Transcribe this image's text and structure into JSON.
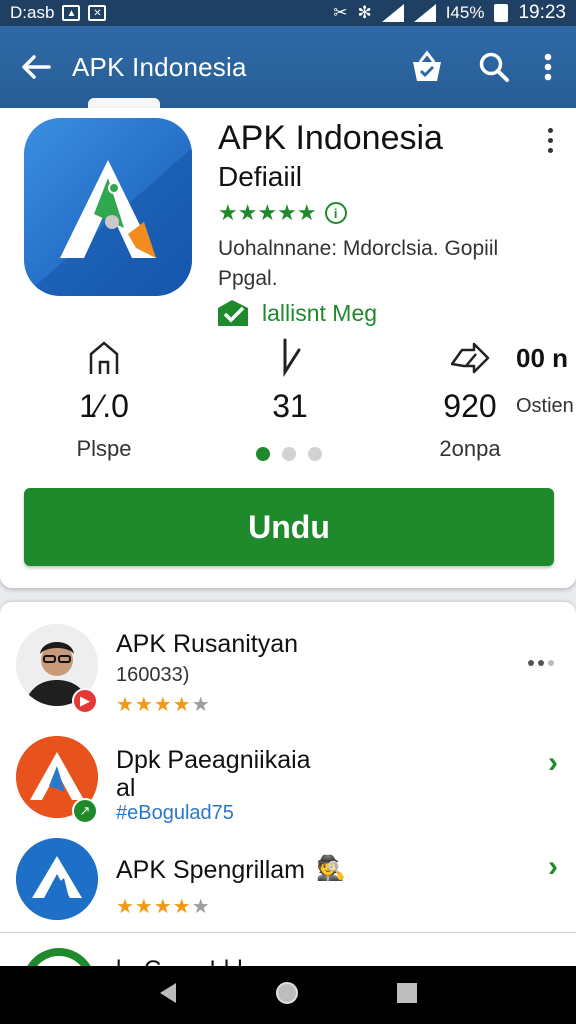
{
  "status_bar": {
    "left_text": "D:asb",
    "battery": "I45%",
    "time": "19:23"
  },
  "app_bar": {
    "title": "APK Indonesia",
    "icons": [
      "back-arrow-icon",
      "basket-check-icon",
      "search-icon",
      "more-vert-icon"
    ]
  },
  "app": {
    "name": "APK Indonesia",
    "subtitle": "Defiaiil",
    "stars": "★★★★★",
    "description": "Uohalnnane: Mdorclsia. Gopiil Ppgal.",
    "installed_label": "lallisnt Meg",
    "accent_color": "#1f8a2c"
  },
  "stats": [
    {
      "icon": "house-icon",
      "value": "1⁄.0",
      "label": "Plspe"
    },
    {
      "icon": "download-icon",
      "value": "31",
      "label": ""
    },
    {
      "icon": "share-arrows-icon",
      "value": "920",
      "label": "2onpa"
    }
  ],
  "stats_extra": {
    "value": "00 n",
    "label": "Ostien"
  },
  "install_button": "Undu",
  "list": [
    {
      "name": "APK Rusanityan",
      "meta": "160033)",
      "stars_on": "★★★★",
      "stars_off": "★",
      "action": "more"
    },
    {
      "name": "Dpk Paeagniikaia",
      "name2": "al",
      "meta": "#eBogulad75",
      "action": "chevron"
    },
    {
      "name": "APK Spengrillam",
      "stars_on": "★★★★",
      "stars_off": "★",
      "action": "chevron"
    }
  ],
  "list_peek": "l-- C------!-l-l--"
}
